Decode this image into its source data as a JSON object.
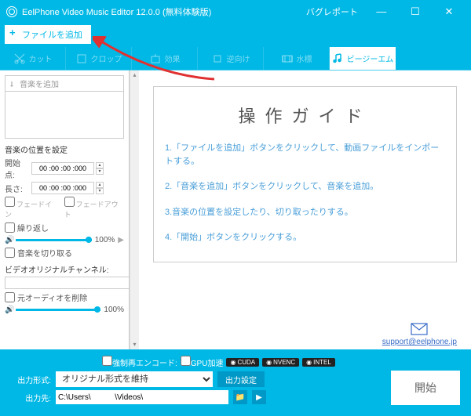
{
  "title": "EelPhone Video Music Editor 12.0.0 (無料体験版)",
  "bug_report": "バグレポート",
  "add_file_btn": "ファイルを追加",
  "tabs": {
    "cut": "カット",
    "crop": "クロップ",
    "effect": "効果",
    "reverse": "逆向け",
    "wm": "水標",
    "bgm": "ビージーエム"
  },
  "left": {
    "add_music": "音楽を追加",
    "pos_label": "音楽の位置を設定",
    "start_label": "開始点:",
    "start_val": "00 :00 :00 :000",
    "len_label": "長さ:",
    "len_val": "00 :00 :00 :000",
    "fadein": "フェードイン",
    "fadeout": "フェードアウト",
    "repeat": "繰り返し",
    "vol1": "100%",
    "trim": "音楽を切り取る",
    "channel": "ビデオオリジナルチャンネル:",
    "remove_orig": "元オーディオを削除",
    "vol2": "100%"
  },
  "guide": {
    "title": "操作ガイド",
    "s1": "1.「ファイルを追加」ボタンをクリックして、動画ファイルをインポートする。",
    "s2": "2.「音楽を追加」ボタンをクリックして、音楽を追加。",
    "s3": "3.音楽の位置を設定したり、切り取ったりする。",
    "s4": "4.「開始」ボタンをクリックする。"
  },
  "support_link": "support@eelphone.jp",
  "footer": {
    "force": "強制再エンコード:",
    "gpu": "GPU加速",
    "cuda": "CUDA",
    "nvenc": "NVENC",
    "intel": "INTEL",
    "format_label": "出力形式:",
    "format_value": "オリジナル形式を維持",
    "out_setting": "出力設定",
    "start": "開始",
    "out_path_label": "出力先:",
    "out_path": "C:\\Users\\           \\Videos\\"
  }
}
